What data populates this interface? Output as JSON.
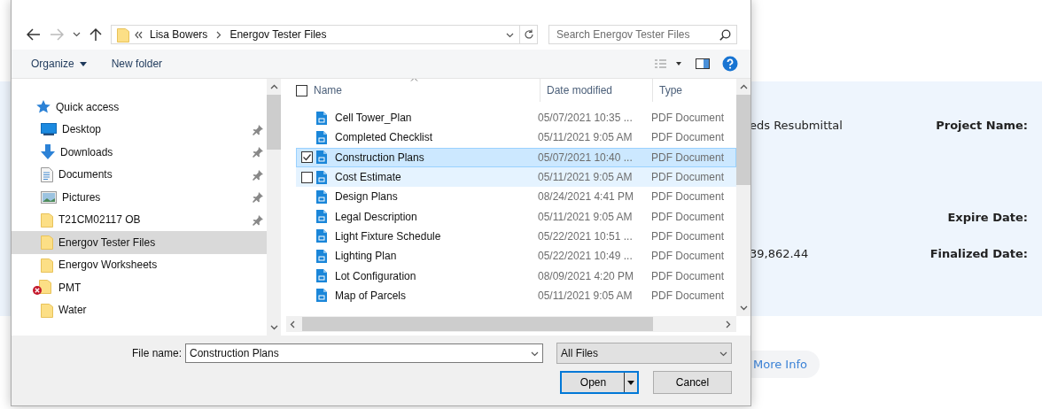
{
  "background_page": {
    "status_text": "eds Resubmittal",
    "amount": "39,862.44",
    "labels": [
      "Project Name:",
      "Expire Date:",
      "Finalized Date:"
    ],
    "more_info": "More Info"
  },
  "dialog": {
    "breadcrumbs": [
      "Lisa Bowers",
      "Energov Tester Files"
    ],
    "search": {
      "placeholder": "Search Energov Tester Files"
    },
    "toolbar": [
      "Organize",
      "New folder"
    ],
    "sidebar": [
      {
        "kind": "star",
        "label": "Quick access",
        "pinned": false,
        "selected": false
      },
      {
        "kind": "desktop",
        "label": "Desktop",
        "pinned": true,
        "selected": false
      },
      {
        "kind": "downloads",
        "label": "Downloads",
        "pinned": true,
        "selected": false
      },
      {
        "kind": "documents",
        "label": "Documents",
        "pinned": true,
        "selected": false
      },
      {
        "kind": "pictures",
        "label": "Pictures",
        "pinned": true,
        "selected": false
      },
      {
        "kind": "folder",
        "label": "T21CM02117 OB",
        "pinned": true,
        "selected": false
      },
      {
        "kind": "folder",
        "label": "Energov Tester Files",
        "pinned": false,
        "selected": true
      },
      {
        "kind": "folder",
        "label": "Energov Worksheets",
        "pinned": false,
        "selected": false
      },
      {
        "kind": "network",
        "label": "PMT",
        "pinned": false,
        "selected": false
      },
      {
        "kind": "folder",
        "label": "Water",
        "pinned": false,
        "selected": false
      }
    ],
    "columns": [
      "Name",
      "Date modified",
      "Type"
    ],
    "select_all_checked": false,
    "files": [
      {
        "name": "Cell Tower_Plan",
        "date": "05/07/2021 10:35 ...",
        "type": "PDF Document",
        "selected": false,
        "hovered": false
      },
      {
        "name": "Completed Checklist",
        "date": "05/11/2021 9:05 AM",
        "type": "PDF Document",
        "selected": false,
        "hovered": false
      },
      {
        "name": "Construction Plans",
        "date": "05/07/2021 10:40 ...",
        "type": "PDF Document",
        "selected": true,
        "hovered": false
      },
      {
        "name": "Cost Estimate",
        "date": "05/11/2021 9:05 AM",
        "type": "PDF Document",
        "selected": false,
        "hovered": true
      },
      {
        "name": "Design Plans",
        "date": "08/24/2021 4:41 PM",
        "type": "PDF Document",
        "selected": false,
        "hovered": false
      },
      {
        "name": "Legal Description",
        "date": "05/11/2021 9:05 AM",
        "type": "PDF Document",
        "selected": false,
        "hovered": false
      },
      {
        "name": "Light Fixture Schedule",
        "date": "05/22/2021 10:51 ...",
        "type": "PDF Document",
        "selected": false,
        "hovered": false
      },
      {
        "name": "Lighting Plan",
        "date": "05/22/2021 10:49 ...",
        "type": "PDF Document",
        "selected": false,
        "hovered": false
      },
      {
        "name": "Lot Configuration",
        "date": "08/09/2021 4:20 PM",
        "type": "PDF Document",
        "selected": false,
        "hovered": false
      },
      {
        "name": "Map of Parcels",
        "date": "05/11/2021 9:05 AM",
        "type": "PDF Document",
        "selected": false,
        "hovered": false
      }
    ],
    "file_name_label": "File name:",
    "file_name": "Construction Plans",
    "file_type": "All Files",
    "buttons": [
      "Open",
      "Cancel"
    ]
  }
}
